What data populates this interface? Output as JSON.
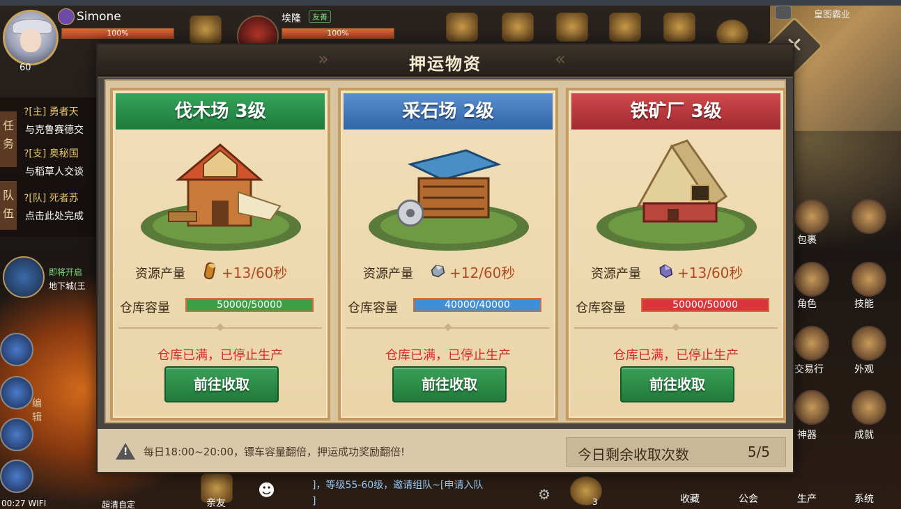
{
  "hud": {
    "player_name": "Simone",
    "player_level": "60",
    "player_hp": "100%",
    "target_name": "埃隆",
    "target_tag": "友善",
    "target_hp": "100%",
    "minimap_title": "皇图霸业",
    "close_glyph": "✕",
    "quest_tabs": [
      "任务",
      "队伍"
    ],
    "quests": [
      {
        "title": "?[主] 勇者天",
        "desc": "与克鲁赛德交"
      },
      {
        "title": "?[支] 奥秘国",
        "desc": "与稻草人交谈"
      },
      {
        "title": "?[队] 死者苏",
        "desc": "点击此处完成"
      }
    ],
    "dungeon_title": "即将开启",
    "dungeon_sub": "地下城(王",
    "edit_label": "编辑",
    "status_time": "00:27 WIFI",
    "status_quality": "超清自定",
    "friends_label": "亲友",
    "chat_line": "]，等级55-60级，邀请组队~[申请入队",
    "chat_line2": "]",
    "item_count": "3",
    "side_menu": [
      "包裹",
      "角色",
      "技能",
      "交易行",
      "外观",
      "神器",
      "成就",
      "生产",
      "系统",
      "收藏",
      "公会"
    ]
  },
  "modal": {
    "title": "押运物资",
    "cards": [
      {
        "name": "伐木场 3级",
        "resource_label": "资源产量",
        "resource_rate": "+13/60秒",
        "resource_icon": "wood-icon",
        "storage_label": "仓库容量",
        "storage_text": "50000/50000",
        "storage_fraction": 1.0,
        "status": "仓库已满，已停止生产",
        "button": "前往收取",
        "color": "#35a45a"
      },
      {
        "name": "采石场 2级",
        "resource_label": "资源产量",
        "resource_rate": "+12/60秒",
        "resource_icon": "stone-icon",
        "storage_label": "仓库容量",
        "storage_text": "40000/40000",
        "storage_fraction": 1.0,
        "status": "仓库已满，已停止生产",
        "button": "前往收取",
        "color": "#3f8ed8"
      },
      {
        "name": "铁矿厂 3级",
        "resource_label": "资源产量",
        "resource_rate": "+13/60秒",
        "resource_icon": "iron-ore-icon",
        "storage_label": "仓库容量",
        "storage_text": "50000/50000",
        "storage_fraction": 1.0,
        "status": "仓库已满，已停止生产",
        "button": "前往收取",
        "color": "#d8343a"
      }
    ],
    "footer_tip": "每日18:00~20:00，镖车容量翻倍，押运成功奖励翻倍!",
    "remaining_label": "今日剩余收取次数",
    "remaining_count": "5/5"
  }
}
